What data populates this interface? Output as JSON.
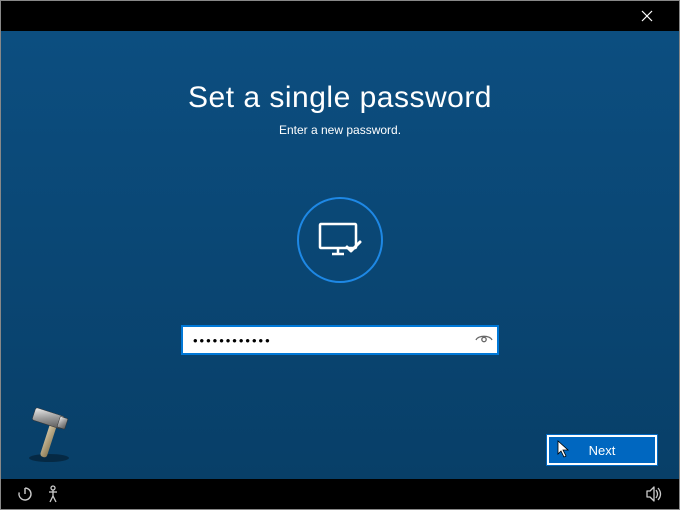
{
  "title": "Set a single password",
  "subtitle": "Enter a new password.",
  "password_value": "••••••••••••",
  "next_label": "Next",
  "icons": {
    "close": "close-icon",
    "monitor": "monitor-check-icon",
    "reveal": "eye-reveal-icon",
    "power": "power-icon",
    "accessibility": "accessibility-icon",
    "volume": "volume-icon",
    "hammer": "hammer-icon",
    "cursor": "cursor-icon"
  },
  "colors": {
    "background": "#0a4a7a",
    "accent": "#0078d7",
    "button": "#0067c0"
  }
}
